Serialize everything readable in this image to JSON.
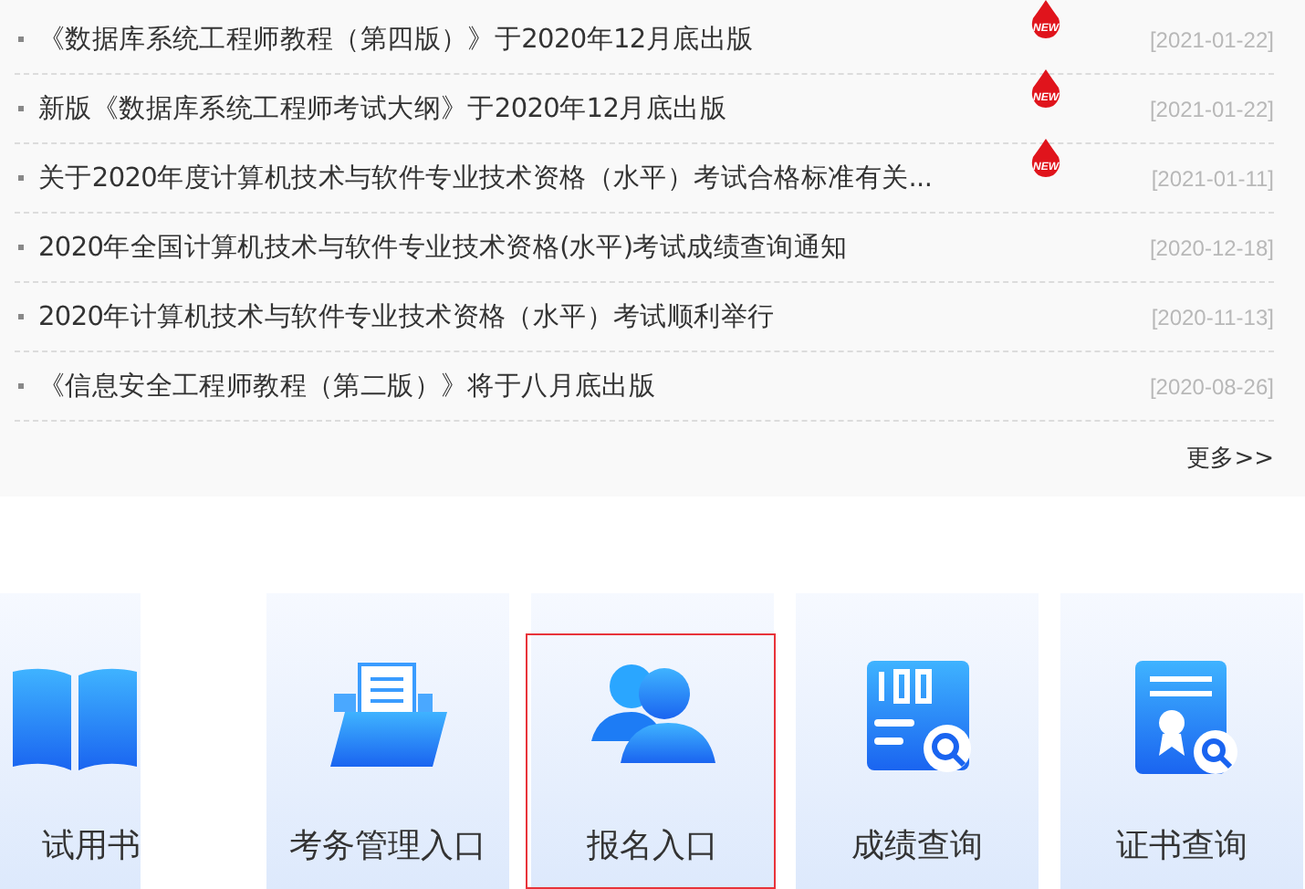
{
  "news": {
    "items": [
      {
        "title": "《数据库系统工程师教程（第四版）》于2020年12月底出版",
        "badge": "NEW",
        "date": "[2021-01-22]"
      },
      {
        "title": "新版《数据库系统工程师考试大纲》于2020年12月底出版",
        "badge": "NEW",
        "date": "[2021-01-22]"
      },
      {
        "title": "关于2020年度计算机技术与软件专业技术资格（水平）考试合格标准有关...",
        "badge": "NEW",
        "date": "[2021-01-11]"
      },
      {
        "title": "2020年全国计算机技术与软件专业技术资格(水平)考试成绩查询通知",
        "date": "[2020-12-18]"
      },
      {
        "title": "2020年计算机技术与软件专业技术资格（水平）考试顺利举行",
        "date": "[2020-11-13]"
      },
      {
        "title": "《信息安全工程师教程（第二版）》将于八月底出版",
        "date": "[2020-08-26]"
      }
    ],
    "more": "更多>>"
  },
  "tiles": [
    {
      "kind": "book",
      "label": "试用书",
      "selected": false
    },
    {
      "kind": "folder",
      "label": "考务管理入口",
      "selected": false
    },
    {
      "kind": "users",
      "label": "报名入口",
      "selected": true
    },
    {
      "kind": "score",
      "label": "成绩查询",
      "selected": false
    },
    {
      "kind": "certificate",
      "label": "证书查询",
      "selected": false
    }
  ]
}
